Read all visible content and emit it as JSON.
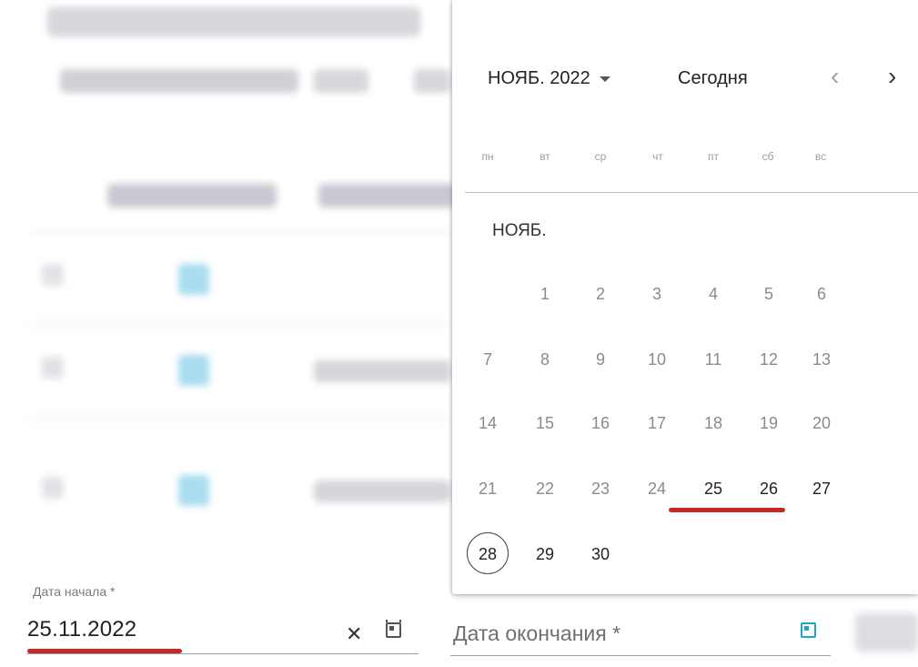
{
  "datepicker": {
    "month_year": "НОЯБ. 2022",
    "today_label": "Сегодня",
    "prev_icon": "chevron-left-icon",
    "next_icon": "chevron-right-icon",
    "weekdays": [
      "пн",
      "вт",
      "ср",
      "чт",
      "пт",
      "сб",
      "вс"
    ],
    "month_label": "НОЯБ.",
    "weeks": [
      [
        "",
        "1",
        "2",
        "3",
        "4",
        "5",
        "6"
      ],
      [
        "7",
        "8",
        "9",
        "10",
        "11",
        "12",
        "13"
      ],
      [
        "14",
        "15",
        "16",
        "17",
        "18",
        "19",
        "20"
      ],
      [
        "21",
        "22",
        "23",
        "24",
        "25",
        "26",
        "27"
      ],
      [
        "28",
        "29",
        "30",
        "",
        "",
        "",
        ""
      ]
    ],
    "today_day": "28",
    "highlight_color": "#c62828"
  },
  "form": {
    "start_date": {
      "label": "Дата начала *",
      "value": "25.11.2022",
      "clear_icon": "close-icon",
      "calendar_icon": "calendar-icon"
    },
    "end_date": {
      "label": "Дата окончания *",
      "calendar_icon": "calendar-icon",
      "accent_color": "#1ea3cf"
    }
  }
}
